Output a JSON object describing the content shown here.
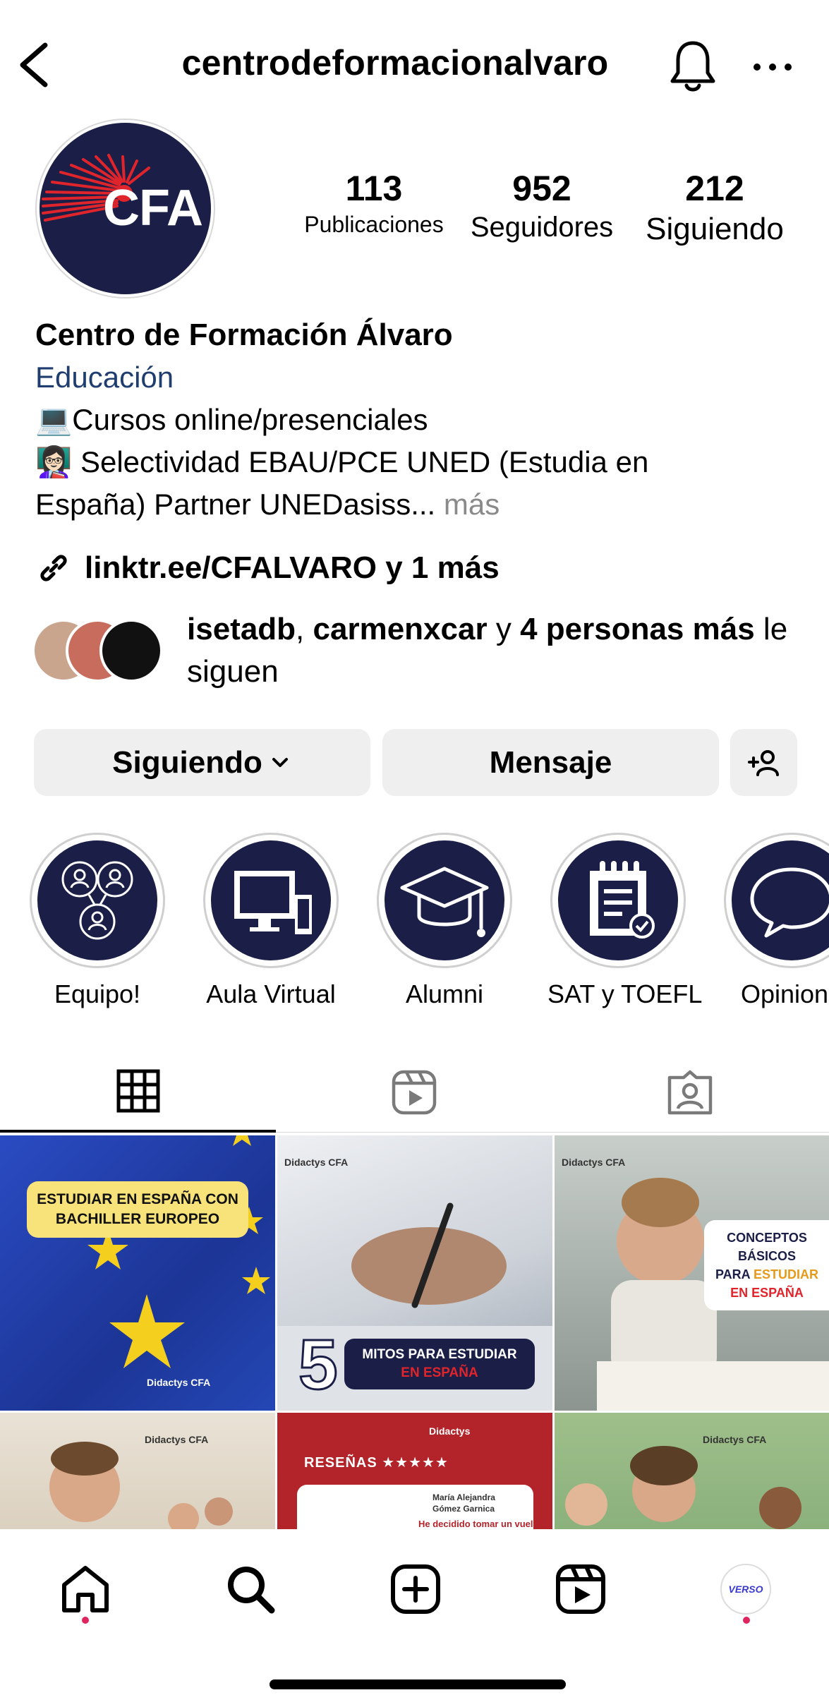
{
  "header": {
    "username": "centrodeformacionalvaro",
    "back_icon": "chevron-left-icon",
    "bell_icon": "bell-icon",
    "more_icon": "more-horizontal-icon"
  },
  "profile": {
    "avatar_text": "CFA",
    "stats": [
      {
        "value": "113",
        "label": "Publicaciones"
      },
      {
        "value": "952",
        "label": "Seguidores"
      },
      {
        "value": "212",
        "label": "Siguiendo"
      }
    ]
  },
  "bio": {
    "name": "Centro de Formación Álvaro",
    "category": "Educación",
    "line1": "💻Cursos online/presenciales",
    "line2": "👩🏻‍🏫 Selectividad EBAU/PCE UNED (Estudia en",
    "line3": "España) Partner UNEDasiss...",
    "more": "más",
    "link": "linktr.ee/CFALVARO y 1 más"
  },
  "followed_by": {
    "user1": "isetadb",
    "separator": ",",
    "user2": "carmenxcar",
    "conj": "y",
    "count": "4 personas más",
    "suffix": "le siguen"
  },
  "actions": {
    "following_label": "Siguiendo",
    "message_label": "Mensaje"
  },
  "highlights": [
    {
      "label": "Equipo!",
      "icon": "team-icon"
    },
    {
      "label": "Aula Virtual",
      "icon": "computer-icon"
    },
    {
      "label": "Alumni",
      "icon": "graduation-cap-icon"
    },
    {
      "label": "SAT y TOEFL",
      "icon": "notepad-icon"
    },
    {
      "label": "Opinione",
      "icon": "speech-bubble-icon"
    }
  ],
  "tabs": [
    "grid-icon",
    "reels-icon",
    "tagged-icon"
  ],
  "posts": [
    {
      "title": "ESTUDIAR EN ESPAÑA CON BACHILLER EUROPEO",
      "brand": "Didactys CFA"
    },
    {
      "title_big": "5",
      "title": "MITOS PARA ESTUDIAR",
      "title_accent": "EN ESPAÑA",
      "brand": "Didactys CFA"
    },
    {
      "title": "CONCEPTOS BÁSICOS",
      "title_mid": "PARA",
      "title_accent1": "ESTUDIAR",
      "title_accent2": "EN ESPAÑA",
      "brand": "Didactys CFA"
    },
    {
      "brand": "Didactys CFA"
    },
    {
      "title": "RESEÑAS ★★★★★",
      "name": "María Alejandra Gómez Garnica",
      "quote": "He decidido tomar un vuelo",
      "brand": "Didactys"
    },
    {
      "brand": "Didactys CFA"
    }
  ],
  "bottom_nav": [
    "home-icon",
    "search-icon",
    "create-icon",
    "reels-icon",
    "profile-avatar-icon"
  ],
  "profile_avatar_text": "VERSO"
}
